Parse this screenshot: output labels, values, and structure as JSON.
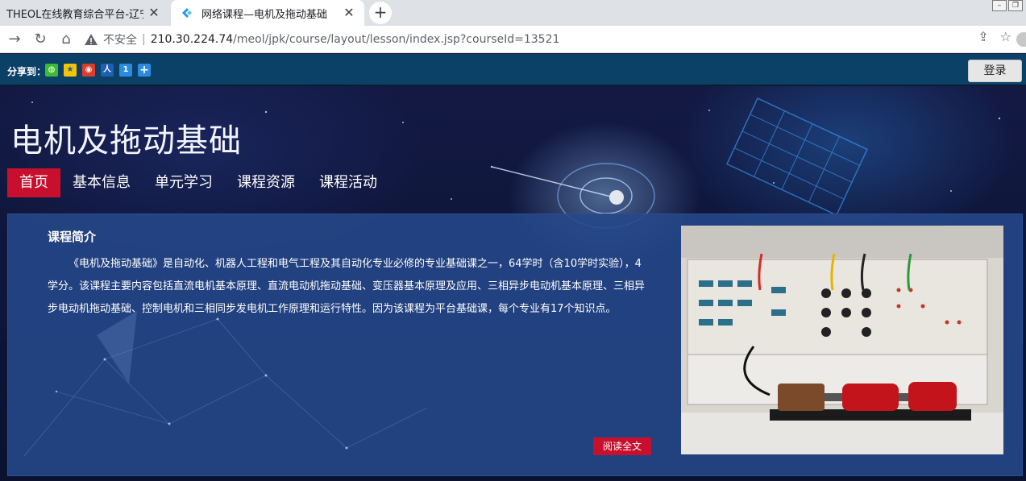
{
  "browser": {
    "tabs": [
      {
        "title": "THEOL在线教育综合平台-辽宁科",
        "active": false
      },
      {
        "title": "网络课程—电机及拖动基础",
        "active": true
      }
    ],
    "security_label": "不安全",
    "url_host": "210.30.224.74",
    "url_path": "/meol/jpk/course/layout/lesson/index.jsp?courseId=13521"
  },
  "sharebar": {
    "label": "分享到：",
    "icons": [
      "wechat-icon",
      "qzone-icon",
      "weibo-icon",
      "renren-icon",
      "kaixin-icon",
      "more-share-icon"
    ],
    "login_label": "登录"
  },
  "course": {
    "title": "电机及拖动基础"
  },
  "nav": {
    "items": [
      {
        "label": "首页",
        "active": true
      },
      {
        "label": "基本信息",
        "active": false
      },
      {
        "label": "单元学习",
        "active": false
      },
      {
        "label": "课程资源",
        "active": false
      },
      {
        "label": "课程活动",
        "active": false
      }
    ]
  },
  "intro": {
    "heading": "课程简介",
    "text": "《电机及拖动基础》是自动化、机器人工程和电气工程及其自动化专业必修的专业基础课之一，64学时（含10学时实验），4学分。该课程主要内容包括直流电机基本原理、直流电动机拖动基础、变压器基本原理及应用、三相异步电动机基本原理、三相异步电动机拖动基础、控制电机和三相同步发电机工作原理和运行特性。因为该课程为平台基础课，每个专业有17个知识点。",
    "read_more": "阅读全文"
  },
  "colors": {
    "accent": "#c8102e",
    "sharebar": "#0c4167",
    "panel": "#26488a"
  }
}
